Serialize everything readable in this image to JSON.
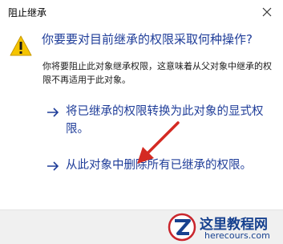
{
  "window": {
    "title": "阻止继承",
    "close_icon": "close-icon"
  },
  "dialog": {
    "warning_icon": "warning-icon",
    "question": "你要要对目前继承的权限采取何种操作?",
    "description": "你将要阻止此对象继承权限，这意味着从父对象中继承的权限不再适用于此对象。"
  },
  "options": [
    {
      "icon": "arrow-right-icon",
      "label": "将已继承的权限转换为此对象的显式权限。"
    },
    {
      "icon": "arrow-right-icon",
      "label": "从此对象中删除所有已继承的权限。"
    }
  ],
  "annotation": {
    "icon": "red-pointer-arrow-icon",
    "color": "#d42a22"
  },
  "watermark": {
    "logo_icon": "watermark-logo-icon",
    "name": "这里教程网",
    "url": "herecours.com"
  },
  "colors": {
    "link_blue": "#1f3d99",
    "warning_yellow": "#f5c400",
    "watermark_blue": "#17418f"
  }
}
